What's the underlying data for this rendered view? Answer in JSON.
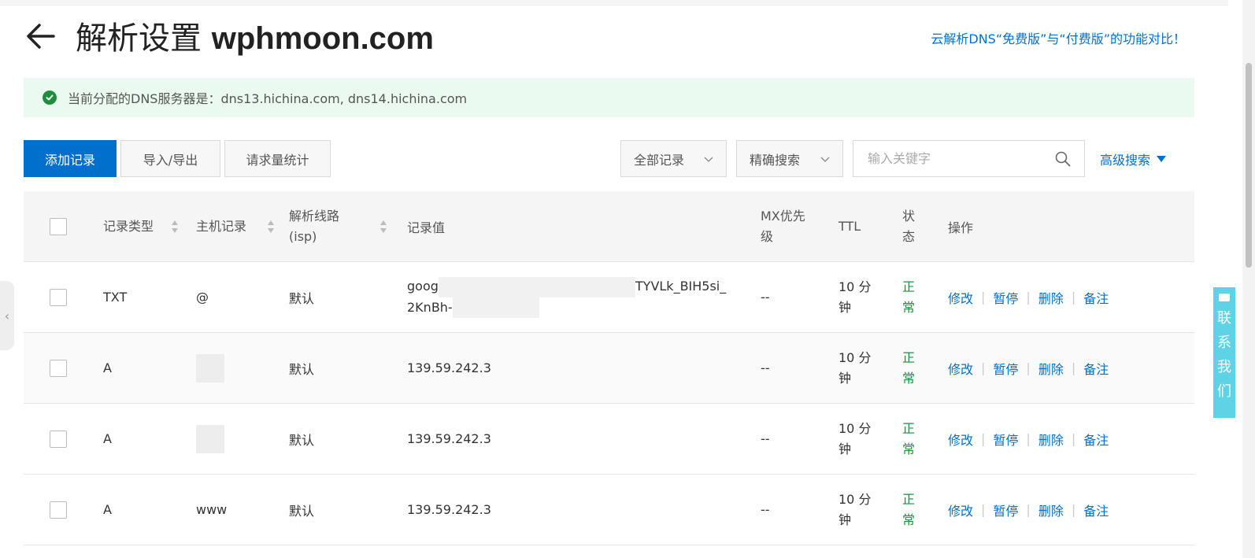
{
  "header": {
    "title": "解析设置",
    "domain": "wphmoon.com",
    "compare_link": "云解析DNS“免费版”与“付费版”的功能对比！"
  },
  "notice": {
    "text": "当前分配的DNS服务器是：dns13.hichina.com, dns14.hichina.com",
    "icon": "check-circle-icon"
  },
  "toolbar": {
    "add_label": "添加记录",
    "import_label": "导入/导出",
    "stats_label": "请求量统计",
    "records_filter": "全部记录",
    "search_mode": "精确搜索",
    "search_placeholder": "输入关键字",
    "advanced_search": "高级搜索"
  },
  "table": {
    "headers": {
      "type": "记录类型",
      "host": "主机记录",
      "line": "解析线路(isp)",
      "value": "记录值",
      "mx": "MX优先级",
      "ttl": "TTL",
      "status": "状态",
      "ops": "操作"
    },
    "rows": [
      {
        "type": "TXT",
        "host": "@",
        "line": "默认",
        "value_start": "goog",
        "value_end": "TYVLk_BIH5si_",
        "value_line2": "2KnBh-",
        "mx": "--",
        "ttl": "10 分钟",
        "status": "正常"
      },
      {
        "type": "A",
        "host": "",
        "line": "默认",
        "value": "139.59.242.3",
        "mx": "--",
        "ttl": "10 分钟",
        "status": "正常"
      },
      {
        "type": "A",
        "host": "",
        "line": "默认",
        "value": "139.59.242.3",
        "mx": "--",
        "ttl": "10 分钟",
        "status": "正常"
      },
      {
        "type": "A",
        "host": "www",
        "line": "默认",
        "value": "139.59.242.3",
        "mx": "--",
        "ttl": "10 分钟",
        "status": "正常"
      }
    ],
    "actions": {
      "edit": "修改",
      "pause": "暂停",
      "delete": "删除",
      "note": "备注"
    }
  },
  "contact": {
    "label": "联系我们"
  },
  "colors": {
    "primary": "#0070cc",
    "success": "#1e8e3e",
    "notice_bg": "#ebfaf0",
    "contact_bg": "#5fd3e6"
  }
}
